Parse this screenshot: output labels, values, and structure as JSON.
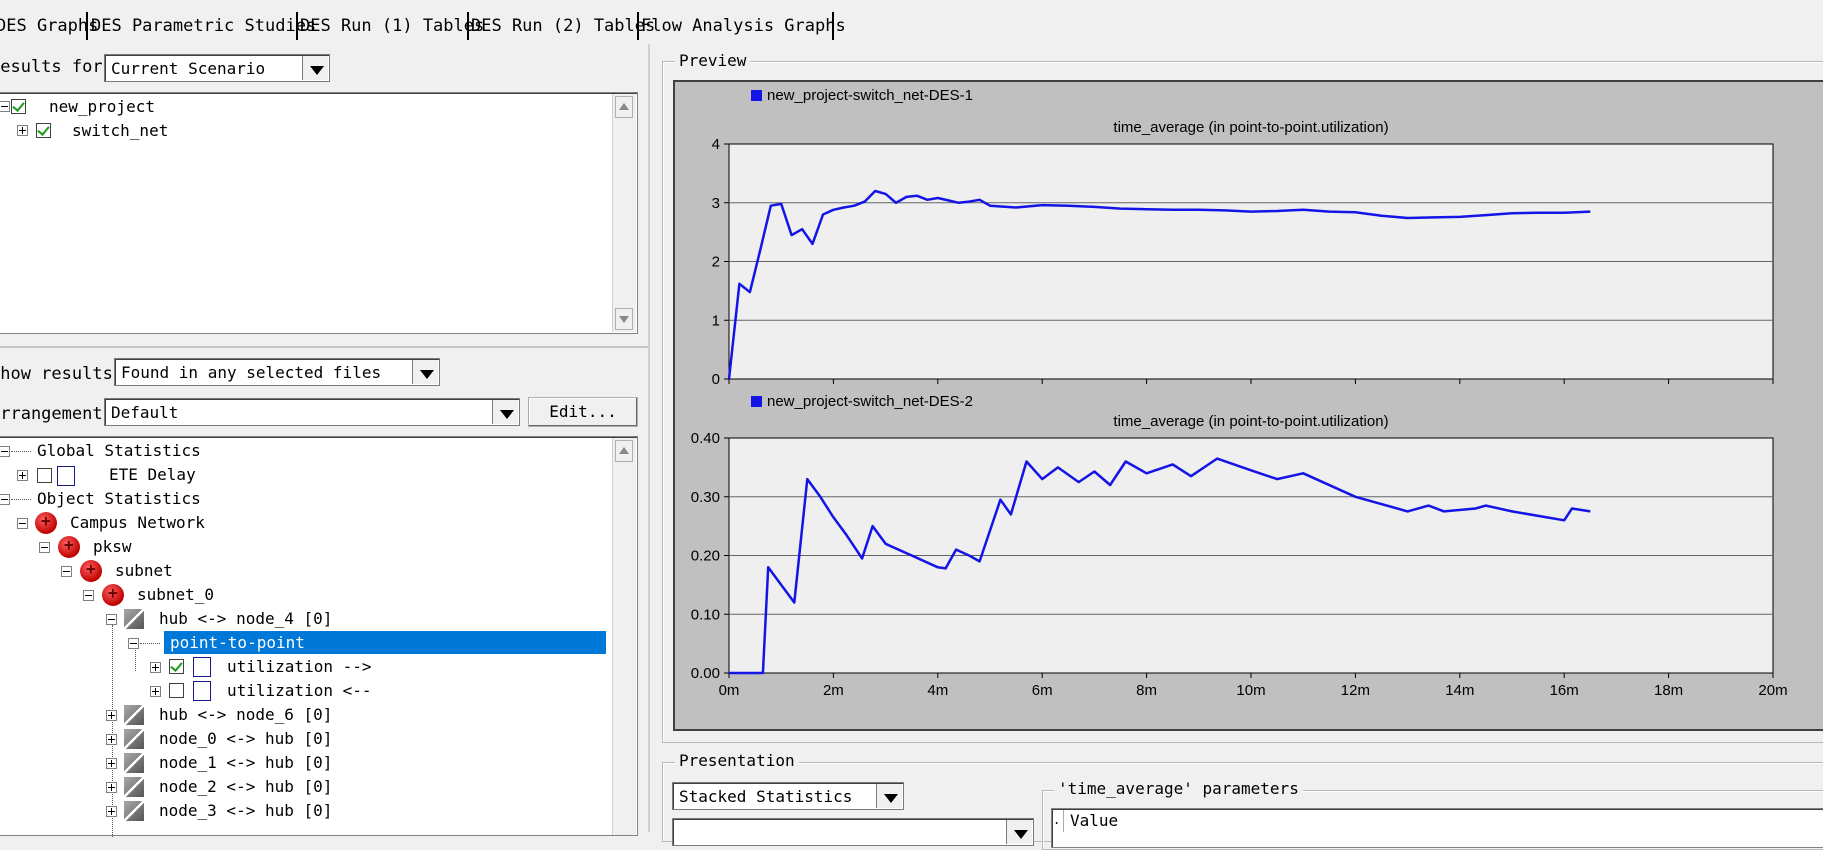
{
  "tabs": [
    {
      "label": "DES Graphs"
    },
    {
      "label": "DES Parametric Studies"
    },
    {
      "label": "DES Run (1) Tables"
    },
    {
      "label": "DES Run (2) Tables"
    },
    {
      "label": "Flow Analysis Graphs"
    }
  ],
  "results_for": {
    "label": "Results for:",
    "value": "Current Scenario"
  },
  "project_tree": [
    {
      "label": "new_project",
      "checked": true
    },
    {
      "label": "switch_net",
      "checked": true
    }
  ],
  "show_results": {
    "label": "Show results:",
    "value": "Found in any selected files"
  },
  "arrangement": {
    "label": "Arrangement:",
    "value": "Default",
    "edit_button": "Edit..."
  },
  "stats_tree": {
    "global_statistics": "Global Statistics",
    "ete_delay": "ETE Delay",
    "object_statistics": "Object Statistics",
    "campus_network": "Campus Network",
    "pksw": "pksw",
    "subnet": "subnet",
    "subnet_0": "subnet_0",
    "link_hub_node4": "hub <-> node_4 [0]",
    "point_to_point": "point-to-point",
    "util_out": "utilization -->",
    "util_in": "utilization <--",
    "links": [
      "hub <-> node_6 [0]",
      "node_0 <-> hub [0]",
      "node_1 <-> hub [0]",
      "node_2 <-> hub [0]",
      "node_3 <-> hub [0]"
    ]
  },
  "preview": {
    "title": "Preview"
  },
  "presentation": {
    "title": "Presentation",
    "mode": "Stacked Statistics",
    "params_title": "'time_average' parameters",
    "value_header": "Value"
  },
  "colors": {
    "series": "#1414e6",
    "selection": "#0078d7",
    "plot_bg": "#efefef"
  },
  "chart_data": [
    {
      "type": "line",
      "legend": "new_project-switch_net-DES-1",
      "title": "time_average (in point-to-point.utilization)",
      "ylim": [
        0,
        4
      ],
      "yticks": [
        "0",
        "1",
        "2",
        "3",
        "4"
      ],
      "xlim": [
        0,
        20
      ],
      "x": [
        0,
        0.2,
        0.4,
        0.6,
        0.8,
        1.0,
        1.2,
        1.4,
        1.6,
        1.8,
        2.0,
        2.2,
        2.4,
        2.6,
        2.8,
        3.0,
        3.2,
        3.4,
        3.6,
        3.8,
        4.0,
        4.2,
        4.4,
        4.6,
        4.8,
        5.0,
        5.5,
        6.0,
        6.5,
        7.0,
        7.5,
        8.0,
        8.5,
        9.0,
        9.5,
        10.0,
        10.5,
        11.0,
        11.5,
        12.0,
        12.5,
        13.0,
        13.5,
        14.0,
        14.5,
        15.0,
        15.5,
        16.0,
        16.5
      ],
      "y": [
        0,
        1.62,
        1.48,
        2.2,
        2.95,
        2.98,
        2.45,
        2.55,
        2.3,
        2.8,
        2.88,
        2.92,
        2.95,
        3.02,
        3.2,
        3.15,
        3.0,
        3.1,
        3.12,
        3.05,
        3.08,
        3.04,
        3.0,
        3.02,
        3.05,
        2.95,
        2.92,
        2.96,
        2.95,
        2.93,
        2.9,
        2.89,
        2.88,
        2.88,
        2.87,
        2.85,
        2.86,
        2.88,
        2.85,
        2.84,
        2.78,
        2.74,
        2.75,
        2.76,
        2.79,
        2.82,
        2.83,
        2.83,
        2.85
      ]
    },
    {
      "type": "line",
      "legend": "new_project-switch_net-DES-2",
      "title": "time_average (in point-to-point.utilization)",
      "ylim": [
        0,
        0.4
      ],
      "yticks": [
        "0.00",
        "0.10",
        "0.20",
        "0.30",
        "0.40"
      ],
      "xlim": [
        0,
        20
      ],
      "xticks": [
        "0m",
        "2m",
        "4m",
        "6m",
        "8m",
        "10m",
        "12m",
        "14m",
        "16m",
        "18m",
        "20m"
      ],
      "x": [
        0,
        0.65,
        0.75,
        1.0,
        1.25,
        1.5,
        1.75,
        2.0,
        2.25,
        2.55,
        2.75,
        3.0,
        3.5,
        4.0,
        4.15,
        4.35,
        4.6,
        4.8,
        5.2,
        5.4,
        5.7,
        6.0,
        6.3,
        6.7,
        7.0,
        7.3,
        7.6,
        8.0,
        8.5,
        8.85,
        9.35,
        10.0,
        10.5,
        11.0,
        12.0,
        13.0,
        13.4,
        13.7,
        14.3,
        14.5,
        15.0,
        16.0,
        16.15,
        16.5
      ],
      "y": [
        0,
        0,
        0.18,
        0.15,
        0.12,
        0.33,
        0.3,
        0.265,
        0.235,
        0.195,
        0.25,
        0.22,
        0.2,
        0.18,
        0.178,
        0.21,
        0.2,
        0.19,
        0.295,
        0.27,
        0.36,
        0.33,
        0.35,
        0.325,
        0.343,
        0.32,
        0.36,
        0.34,
        0.355,
        0.335,
        0.365,
        0.345,
        0.33,
        0.34,
        0.3,
        0.275,
        0.285,
        0.275,
        0.28,
        0.285,
        0.275,
        0.26,
        0.28,
        0.275
      ]
    }
  ]
}
